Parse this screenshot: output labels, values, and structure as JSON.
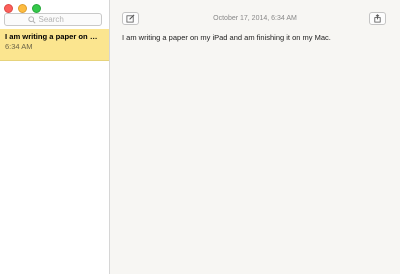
{
  "window": {
    "controls": [
      "close",
      "minimize",
      "zoom"
    ]
  },
  "sidebar": {
    "search": {
      "placeholder": "Search",
      "value": ""
    },
    "notes": [
      {
        "title": "I am writing a paper on my...",
        "time": "6:34 AM",
        "selected": true
      }
    ]
  },
  "editor": {
    "date": "October 17, 2014, 6:34 AM",
    "body": "I am writing a paper on my iPad and am finishing it on my Mac.",
    "toolbar": {
      "compose_icon": "compose-icon",
      "share_icon": "share-icon"
    }
  },
  "colors": {
    "selected_note_bg": "#fbe58f",
    "editor_bg": "#f7f6f3"
  }
}
